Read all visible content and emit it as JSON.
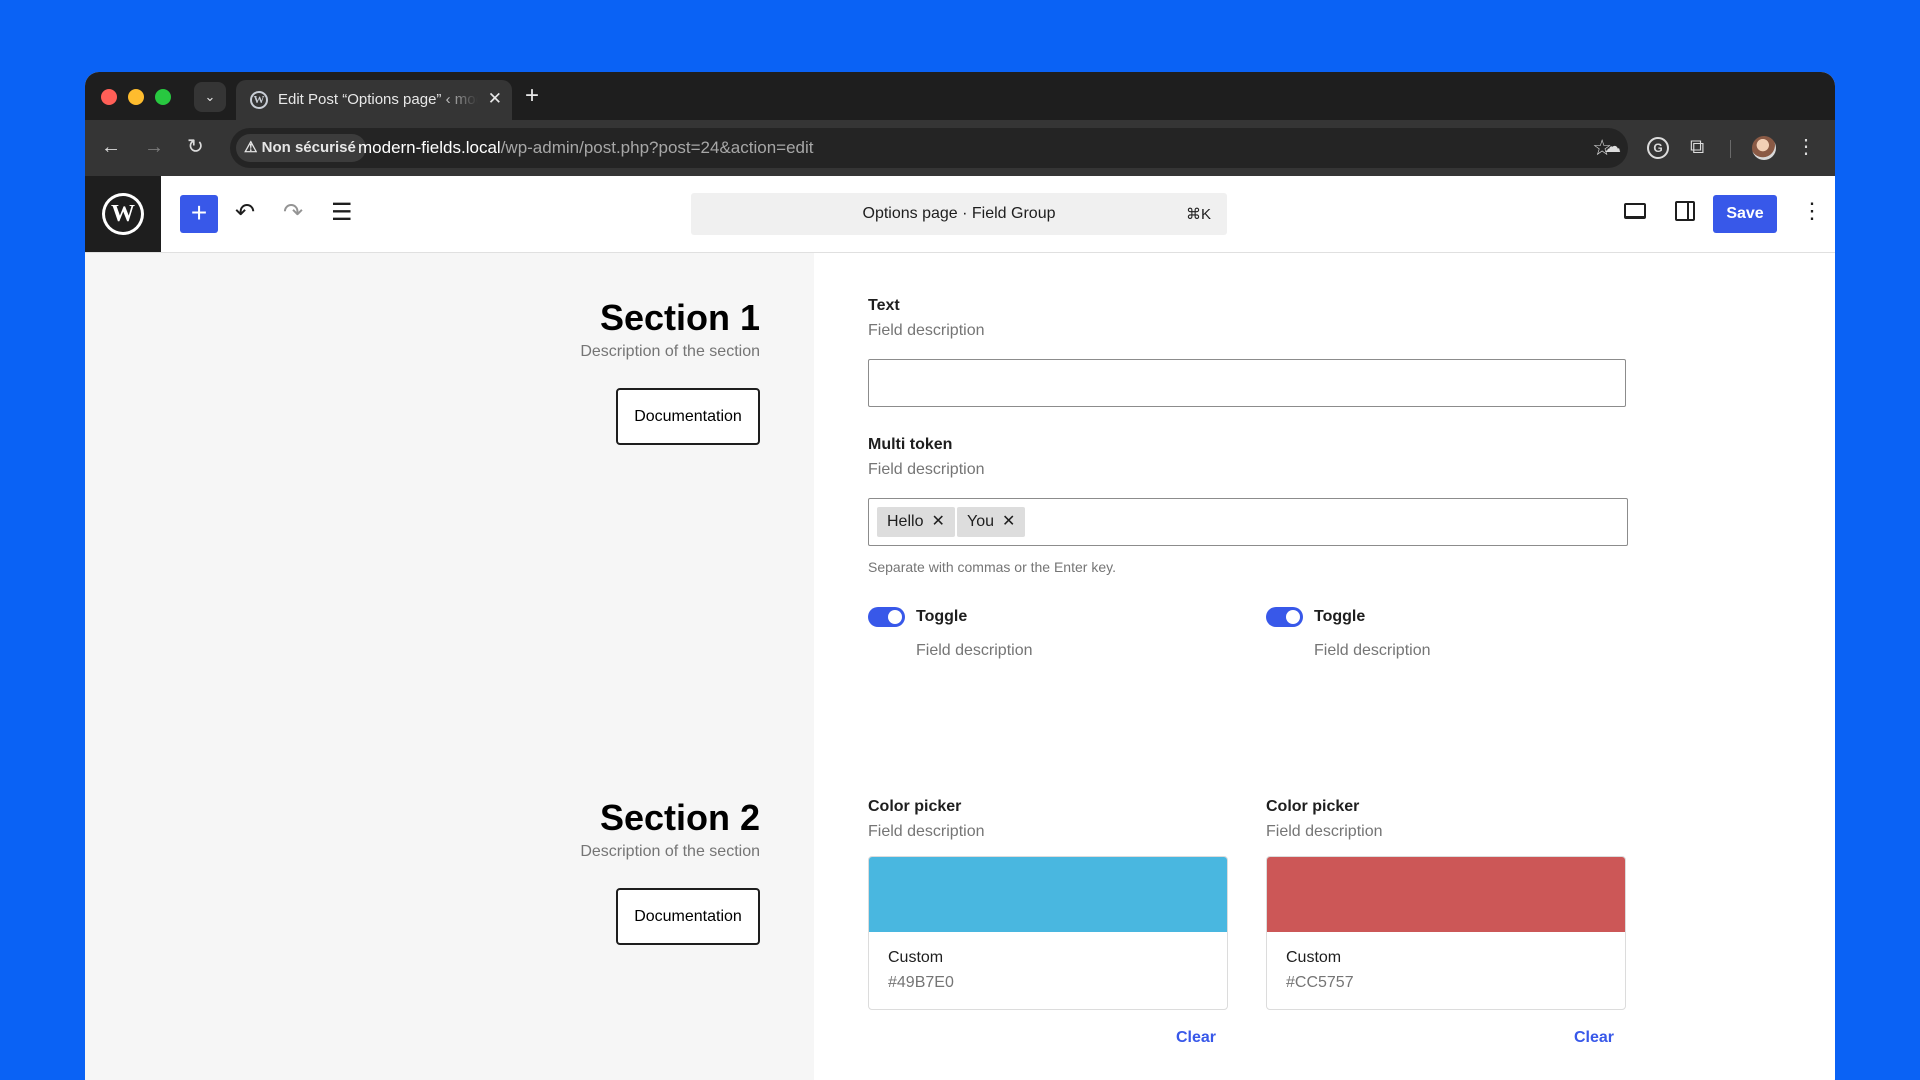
{
  "browser": {
    "tab_title": "Edit Post “Options page” ‹ modern-fields",
    "tab_close": "✕",
    "new_tab": "+",
    "security_label": "Non sécurisé",
    "url_host": "modern-fields.local",
    "url_path": "/wp-admin/post.php?post=24&action=edit"
  },
  "editor": {
    "command_title": "Options page · Field Group",
    "command_shortcut": "⌘K",
    "save_label": "Save"
  },
  "sections": [
    {
      "title": "Section 1",
      "description": "Description of the section",
      "button": "Documentation"
    },
    {
      "title": "Section 2",
      "description": "Description of the section",
      "button": "Documentation"
    }
  ],
  "fields": {
    "text": {
      "label": "Text",
      "description": "Field description",
      "value": ""
    },
    "multi_token": {
      "label": "Multi token",
      "description": "Field description",
      "tokens": [
        "Hello",
        "You"
      ],
      "help": "Separate with commas or the Enter key."
    },
    "toggles": [
      {
        "label": "Toggle",
        "description": "Field description",
        "checked": true
      },
      {
        "label": "Toggle",
        "description": "Field description",
        "checked": true
      }
    ],
    "color_pickers": [
      {
        "label": "Color picker",
        "description": "Field description",
        "name": "Custom",
        "hex": "#49B7E0",
        "clear": "Clear"
      },
      {
        "label": "Color picker",
        "description": "Field description",
        "name": "Custom",
        "hex": "#CC5757",
        "clear": "Clear"
      }
    ]
  },
  "colors": {
    "accent": "#3858e9",
    "background": "#0a62f5"
  },
  "icons": [
    "chevron-down-icon",
    "wordpress-icon",
    "close-icon",
    "plus-icon",
    "back-arrow-icon",
    "forward-arrow-icon",
    "reload-icon",
    "warning-icon",
    "star-icon",
    "cloud-icon",
    "grammarly-icon",
    "puzzle-icon",
    "avatar",
    "kebab-menu-icon",
    "undo-icon",
    "redo-icon",
    "list-view-icon",
    "preview-icon",
    "sidebar-icon"
  ]
}
